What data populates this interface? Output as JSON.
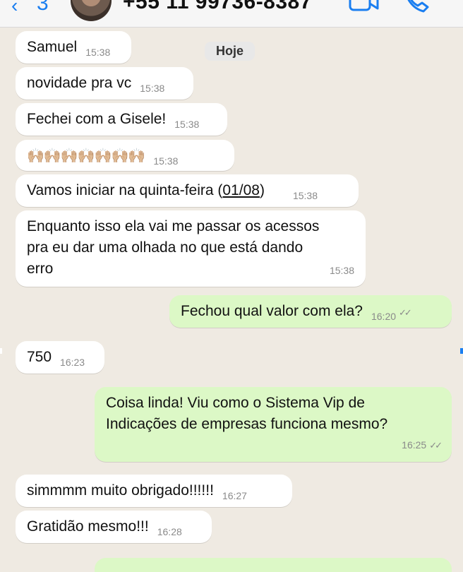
{
  "header": {
    "back_icon": "‹",
    "back_count": "3",
    "contact": "+55 11 99736-8387",
    "video_icon": "video-camera-icon",
    "call_icon": "phone-icon"
  },
  "date_chip": "Hoje",
  "messages": [
    {
      "text": "Samuel",
      "time": "15:38"
    },
    {
      "text": "novidade pra vc",
      "time": "15:38"
    },
    {
      "text": "Fechei com a Gisele!",
      "time": "15:38"
    },
    {
      "text": "🙌🏼🙌🏼🙌🏼🙌🏼🙌🏼🙌🏼🙌🏼",
      "time": "15:38"
    },
    {
      "text_before": "Vamos iniciar na quinta-feira (",
      "date_link": "01/08",
      "text_after": ")",
      "time": "15:38"
    },
    {
      "text_lines": [
        "Enquanto isso ela vai me passar os acessos",
        "pra eu dar uma olhada no que está dando",
        "erro"
      ],
      "time": "15:38"
    },
    {
      "text": "Fechou qual valor com ela?",
      "time": "16:20",
      "ticks": "✓✓"
    },
    {
      "text": "750",
      "time": "16:23"
    },
    {
      "text_lines": [
        "Coisa linda! Viu como o Sistema Vip de",
        "Indicações de empresas funciona mesmo?"
      ],
      "time": "16:25",
      "ticks": "✓✓"
    },
    {
      "text": "simmmm muito obrigado!!!!!!",
      "time": "16:27"
    },
    {
      "text": "Gratidão mesmo!!!",
      "time": "16:28"
    }
  ],
  "colors": {
    "background": "#efeae2",
    "incoming_bubble": "#ffffff",
    "outgoing_bubble": "#dcf8c6",
    "accent": "#1a7ef0"
  }
}
